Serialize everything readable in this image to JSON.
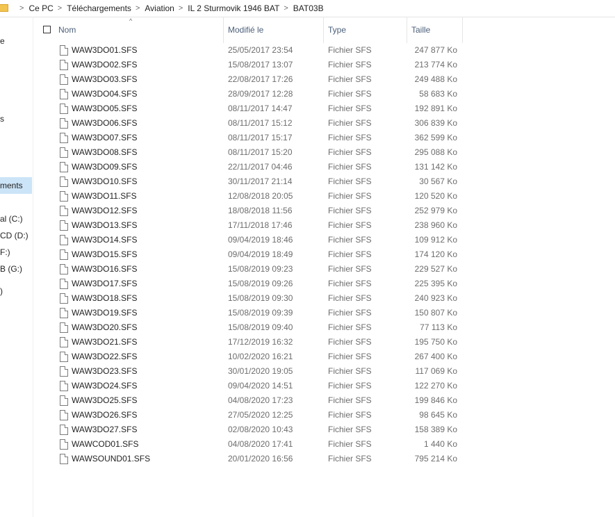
{
  "breadcrumb": [
    "Ce PC",
    "Téléchargements",
    "Aviation",
    "IL 2 Sturmovik 1946 BAT",
    "BAT03B"
  ],
  "nav": {
    "items": [
      "e",
      "s",
      "ments",
      "al (C:)",
      "CD (D:)",
      "F:)",
      "B (G:)",
      ")"
    ]
  },
  "columns": {
    "name": "Nom",
    "modified": "Modifié le",
    "type": "Type",
    "size": "Taille"
  },
  "sort_indicator": "^",
  "files": [
    {
      "name": "WAW3DO01.SFS",
      "modified": "25/05/2017 23:54",
      "type": "Fichier SFS",
      "size": "247 877 Ko"
    },
    {
      "name": "WAW3DO02.SFS",
      "modified": "15/08/2017 13:07",
      "type": "Fichier SFS",
      "size": "213 774 Ko"
    },
    {
      "name": "WAW3DO03.SFS",
      "modified": "22/08/2017 17:26",
      "type": "Fichier SFS",
      "size": "249 488 Ko"
    },
    {
      "name": "WAW3DO04.SFS",
      "modified": "28/09/2017 12:28",
      "type": "Fichier SFS",
      "size": "58 683 Ko"
    },
    {
      "name": "WAW3DO05.SFS",
      "modified": "08/11/2017 14:47",
      "type": "Fichier SFS",
      "size": "192 891 Ko"
    },
    {
      "name": "WAW3DO06.SFS",
      "modified": "08/11/2017 15:12",
      "type": "Fichier SFS",
      "size": "306 839 Ko"
    },
    {
      "name": "WAW3DO07.SFS",
      "modified": "08/11/2017 15:17",
      "type": "Fichier SFS",
      "size": "362 599 Ko"
    },
    {
      "name": "WAW3DO08.SFS",
      "modified": "08/11/2017 15:20",
      "type": "Fichier SFS",
      "size": "295 088 Ko"
    },
    {
      "name": "WAW3DO09.SFS",
      "modified": "22/11/2017 04:46",
      "type": "Fichier SFS",
      "size": "131 142 Ko"
    },
    {
      "name": "WAW3DO10.SFS",
      "modified": "30/11/2017 21:14",
      "type": "Fichier SFS",
      "size": "30 567 Ko"
    },
    {
      "name": "WAW3DO11.SFS",
      "modified": "12/08/2018 20:05",
      "type": "Fichier SFS",
      "size": "120 520 Ko"
    },
    {
      "name": "WAW3DO12.SFS",
      "modified": "18/08/2018 11:56",
      "type": "Fichier SFS",
      "size": "252 979 Ko"
    },
    {
      "name": "WAW3DO13.SFS",
      "modified": "17/11/2018 17:46",
      "type": "Fichier SFS",
      "size": "238 960 Ko"
    },
    {
      "name": "WAW3DO14.SFS",
      "modified": "09/04/2019 18:46",
      "type": "Fichier SFS",
      "size": "109 912 Ko"
    },
    {
      "name": "WAW3DO15.SFS",
      "modified": "09/04/2019 18:49",
      "type": "Fichier SFS",
      "size": "174 120 Ko"
    },
    {
      "name": "WAW3DO16.SFS",
      "modified": "15/08/2019 09:23",
      "type": "Fichier SFS",
      "size": "229 527 Ko"
    },
    {
      "name": "WAW3DO17.SFS",
      "modified": "15/08/2019 09:26",
      "type": "Fichier SFS",
      "size": "225 395 Ko"
    },
    {
      "name": "WAW3DO18.SFS",
      "modified": "15/08/2019 09:30",
      "type": "Fichier SFS",
      "size": "240 923 Ko"
    },
    {
      "name": "WAW3DO19.SFS",
      "modified": "15/08/2019 09:39",
      "type": "Fichier SFS",
      "size": "150 807 Ko"
    },
    {
      "name": "WAW3DO20.SFS",
      "modified": "15/08/2019 09:40",
      "type": "Fichier SFS",
      "size": "77 113 Ko"
    },
    {
      "name": "WAW3DO21.SFS",
      "modified": "17/12/2019 16:32",
      "type": "Fichier SFS",
      "size": "195 750 Ko"
    },
    {
      "name": "WAW3DO22.SFS",
      "modified": "10/02/2020 16:21",
      "type": "Fichier SFS",
      "size": "267 400 Ko"
    },
    {
      "name": "WAW3DO23.SFS",
      "modified": "30/01/2020 19:05",
      "type": "Fichier SFS",
      "size": "117 069 Ko"
    },
    {
      "name": "WAW3DO24.SFS",
      "modified": "09/04/2020 14:51",
      "type": "Fichier SFS",
      "size": "122 270 Ko"
    },
    {
      "name": "WAW3DO25.SFS",
      "modified": "04/08/2020 17:23",
      "type": "Fichier SFS",
      "size": "199 846 Ko"
    },
    {
      "name": "WAW3DO26.SFS",
      "modified": "27/05/2020 12:25",
      "type": "Fichier SFS",
      "size": "98 645 Ko"
    },
    {
      "name": "WAW3DO27.SFS",
      "modified": "02/08/2020 10:43",
      "type": "Fichier SFS",
      "size": "158 389 Ko"
    },
    {
      "name": "WAWCOD01.SFS",
      "modified": "04/08/2020 17:41",
      "type": "Fichier SFS",
      "size": "1 440 Ko"
    },
    {
      "name": "WAWSOUND01.SFS",
      "modified": "20/01/2020 16:56",
      "type": "Fichier SFS",
      "size": "795 214 Ko"
    }
  ]
}
